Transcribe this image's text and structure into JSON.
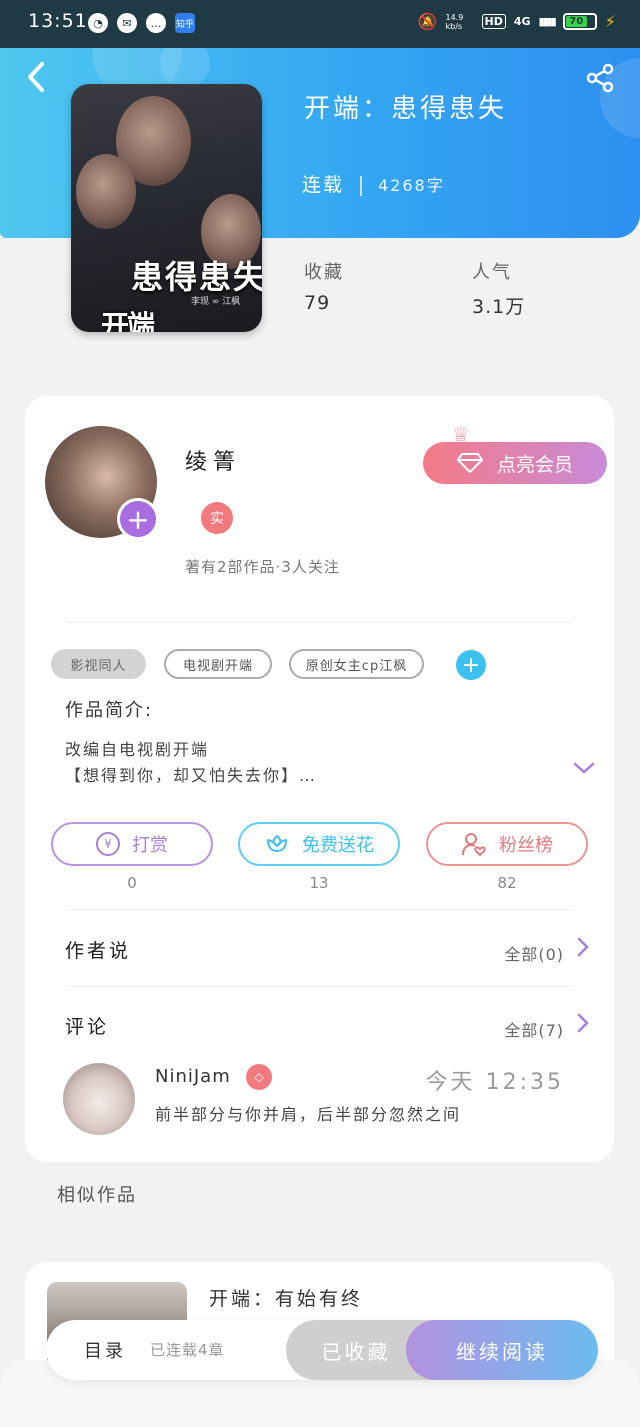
{
  "status_bar": {
    "time": "13:51",
    "zhihu": "知乎",
    "net_speed": "14.9 kb/s",
    "hd": "HD",
    "signal": "4G",
    "battery": "70"
  },
  "book": {
    "title": "开端：患得患失",
    "status": "连载",
    "word_count": "4268字",
    "cover_title": "患得患失",
    "cover_names": "李现 ∞ 江枫",
    "cover_logo": "开端",
    "favorites_label": "收藏",
    "favorites_value": "79",
    "popularity_label": "人气",
    "popularity_value": "3.1万"
  },
  "author": {
    "name": "绫箐",
    "real_badge": "实",
    "meta": "著有2部作品·3人关注",
    "vip_button": "点亮会员"
  },
  "tags": [
    "影视同人",
    "电视剧开端",
    "原创女主cp江枫"
  ],
  "intro": {
    "title": "作品简介:",
    "line1": "改编自电视剧开端",
    "line2": "【想得到你，却又怕失去你】…"
  },
  "actions": [
    {
      "label": "打赏",
      "count": "0",
      "color": "#a77fd8"
    },
    {
      "label": "免费送花",
      "count": "13",
      "color": "#3cc0ee"
    },
    {
      "label": "粉丝榜",
      "count": "82",
      "color": "#e57a7e"
    }
  ],
  "author_says": {
    "title": "作者说",
    "more": "全部(0)"
  },
  "comments": {
    "title": "评论",
    "more": "全部(7)",
    "item": {
      "user": "NiniJam",
      "time": "今天 12:35",
      "text": "前半部分与你并肩，后半部分忽然之间"
    }
  },
  "similar": {
    "title": "相似作品",
    "first_title": "开端：有始有终"
  },
  "bottom": {
    "toc": "目录",
    "toc_sub": "已连载4章",
    "favorited": "已收藏",
    "continue": "继续阅读"
  }
}
